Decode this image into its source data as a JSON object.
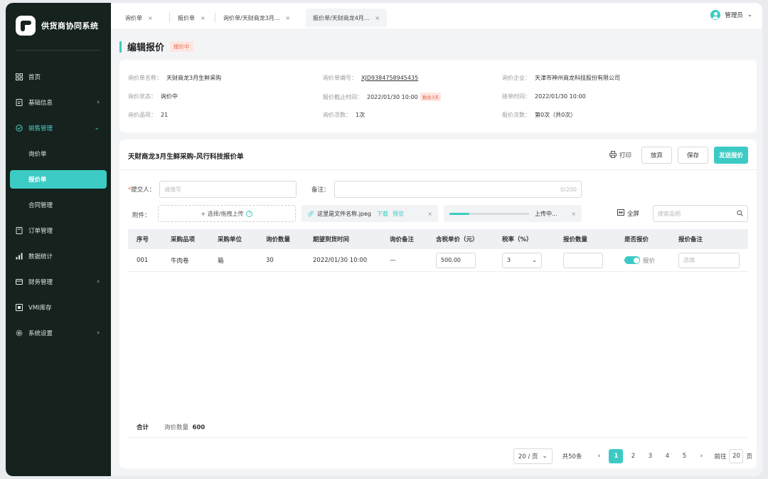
{
  "app": {
    "name": "供货商协同系统"
  },
  "sidebar": {
    "items": [
      {
        "icon": "home-icon",
        "label": "首页"
      },
      {
        "icon": "file-icon",
        "label": "基础信息",
        "chevron": "›"
      },
      {
        "icon": "sales-icon",
        "label": "销售管理",
        "chevron": "⌄"
      },
      {
        "icon": "order-icon",
        "label": "订单管理"
      },
      {
        "icon": "chart-icon",
        "label": "数据统计"
      },
      {
        "icon": "finance-icon",
        "label": "财务管理",
        "chevron": "›"
      },
      {
        "icon": "inventory-icon",
        "label": "VMI库存"
      },
      {
        "icon": "gear-icon",
        "label": "系统设置",
        "chevron": "›"
      }
    ],
    "sub_items": [
      "询价单",
      "报价单",
      "合同管理"
    ]
  },
  "tabs": [
    {
      "label": "询价单"
    },
    {
      "label": "报价单"
    },
    {
      "label": "询价单/天财商龙3月..."
    },
    {
      "label": "报价单/天财商龙4月..."
    }
  ],
  "user": {
    "name": "管理员"
  },
  "page": {
    "title": "编辑报价",
    "status": "报价中"
  },
  "info": {
    "fields": [
      {
        "k": "询价单名称：",
        "v": "天财商龙3月生鲜采购"
      },
      {
        "k": "询价单编号：",
        "v": "XJD9384758945435"
      },
      {
        "k": "询价企业：",
        "v": "天津市神州商龙科技股份有限公司"
      },
      {
        "k": "询价状态：",
        "v": "询价中"
      },
      {
        "k": "报价截止时间：",
        "v": "2022/01/30 10:00",
        "tag": "剩余3天"
      },
      {
        "k": "接单时间：",
        "v": "2022/01/30 10:00"
      },
      {
        "k": "询价品项：",
        "v": "21"
      },
      {
        "k": "询价次数：",
        "v": "1次"
      },
      {
        "k": "报价次数：",
        "v": "第0次（共0次）"
      }
    ]
  },
  "form": {
    "title": "天财商龙3月生鲜采购-风行科技报价单",
    "print": "打印",
    "abandon": "放弃",
    "save": "保存",
    "send": "发送报价",
    "submitter_label": "提交人：",
    "submitter_placeholder": "请填写",
    "remark_label": "备注：",
    "remark_counter": "0/200",
    "attachment_label": "附件：",
    "upload_text": "+ 选择/拖拽上传",
    "file_name": "这里是文件名称.jpeg",
    "download": "下载",
    "preview": "预览",
    "uploading_text": "上传中...",
    "upload_progress": 0.25,
    "fullscreen": "全屏",
    "search_placeholder": "搜索品相"
  },
  "table": {
    "headers": [
      "序号",
      "采购品项",
      "采购单位",
      "询价数量",
      "期望到货时间",
      "询价备注",
      "含税单价（元）",
      "税率（%）",
      "报价数量",
      "是否报价",
      "报价备注"
    ],
    "rows": [
      {
        "no": "001",
        "item": "牛肉卷",
        "unit": "箱",
        "qty": "30",
        "date": "2022/01/30 10:00",
        "remark": "—",
        "price": "500.00",
        "tax": "3",
        "quote_qty": "",
        "quote_flag": "报价",
        "quote_remark_placeholder": "选填"
      }
    ]
  },
  "summary": {
    "label": "合计",
    "qty_label": "询价数量",
    "qty_value": "600"
  },
  "pagination": {
    "page_size": "20 / 页",
    "total": "共50条",
    "pages": [
      "1",
      "2",
      "3",
      "4",
      "5"
    ],
    "current": "1",
    "goto_label": "前往",
    "goto_value": "20",
    "page_suffix": "页"
  },
  "colors": {
    "accent": "#3ccbc4",
    "sidebar_bg": "#15221e",
    "badge_bg": "#fde6e2",
    "badge_text": "#e8684a"
  }
}
